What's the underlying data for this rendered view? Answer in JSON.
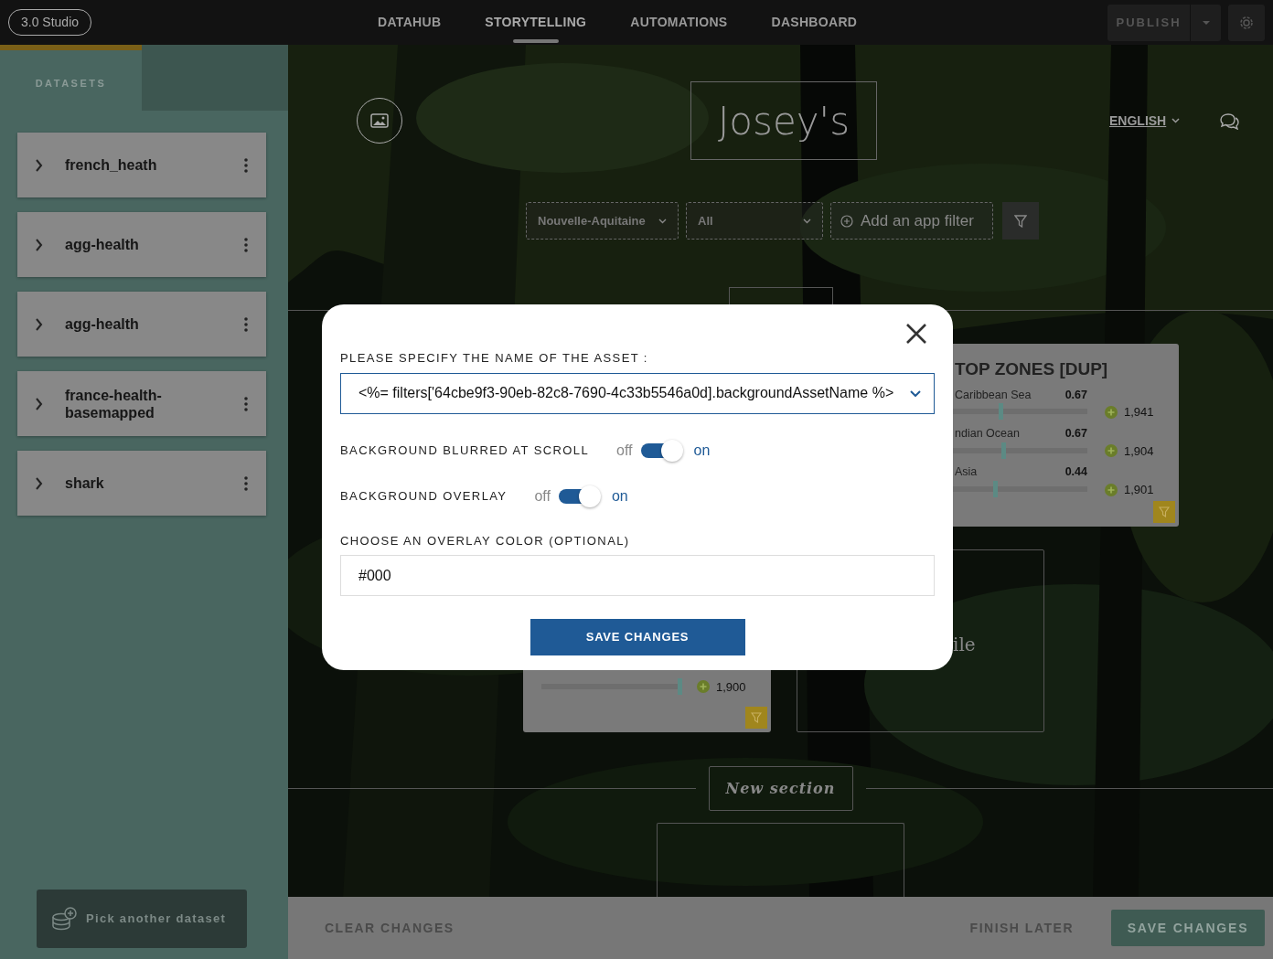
{
  "topbar": {
    "brand": "3.0 Studio",
    "nav": [
      {
        "label": "DATAHUB",
        "selected": false
      },
      {
        "label": "STORYTELLING",
        "selected": true
      },
      {
        "label": "AUTOMATIONS",
        "selected": false
      },
      {
        "label": "DASHBOARD",
        "selected": false
      }
    ],
    "publish_button": "PUBLISH"
  },
  "sidebar": {
    "tabs": [
      {
        "label": "DATASETS",
        "selected": true
      }
    ],
    "datasets": [
      {
        "name": "french_heath"
      },
      {
        "name": "agg-health"
      },
      {
        "name": "agg-health"
      },
      {
        "name": "france-health-basemapped"
      },
      {
        "name": "shark"
      }
    ],
    "pick_button": "Pick another dataset"
  },
  "story": {
    "title": "Josey's",
    "language": "ENGLISH",
    "filters": [
      {
        "kind": "select",
        "value": "Nouvelle-Aquitaine"
      },
      {
        "kind": "select",
        "value": "All"
      },
      {
        "kind": "add",
        "value": "Add an app filter"
      }
    ],
    "top_zones": {
      "title": "TOP ZONES [DUP]",
      "rows": [
        {
          "label": "Caribbean Sea",
          "value": "0.67",
          "count": "1,941",
          "level": 0.37
        },
        {
          "label": "ndian Ocean",
          "value": "0.67",
          "count": "1,904",
          "level": 0.39
        },
        {
          "label": "Asia",
          "value": "0.44",
          "count": "1,901",
          "level": 0.33
        }
      ]
    },
    "left_card": {
      "rows": [
        {
          "count": "1,900",
          "level": 1
        }
      ]
    },
    "right_card": {
      "text": "ile"
    },
    "new_section": "New section"
  },
  "bottom_bar": {
    "clear": "CLEAR CHANGES",
    "finish": "FINISH LATER",
    "save": "SAVE CHANGES"
  },
  "modal": {
    "asset_label": "PLEASE SPECIFY THE NAME OF THE ASSET :",
    "asset_value": "<%= filters['64cbe9f3-90eb-82c8-7690-4c33b5546a0d].backgroundAssetName %>",
    "toggles": [
      {
        "label": "BACKGROUND BLURRED AT SCROLL",
        "off_label": "off",
        "on_label": "on",
        "on": true
      },
      {
        "label": "BACKGROUND OVERLAY",
        "off_label": "off",
        "on_label": "on",
        "on": true
      }
    ],
    "color_label": "CHOOSE AN OVERLAY COLOR (OPTIONAL)",
    "color_value": "#000",
    "save_button": "SAVE CHANGES"
  }
}
